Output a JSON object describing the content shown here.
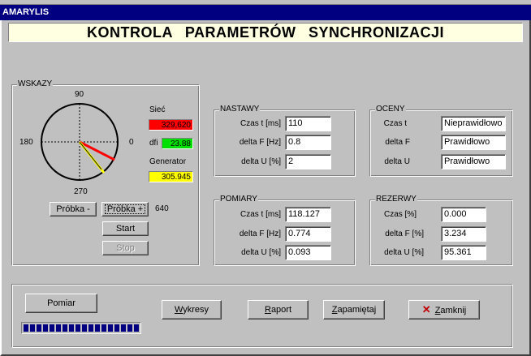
{
  "window": {
    "title": "AMARYLIS"
  },
  "banner": {
    "text": "KONTROLA   PARAMETRÓW   SYNCHRONIZACJI"
  },
  "wskazy": {
    "title": "WSKAZY",
    "dial": {
      "top": "90",
      "left": "180",
      "right": "0",
      "bottom": "270"
    },
    "siec_label": "Sieć",
    "siec_value": "329,620",
    "dfi_label": "dfi",
    "dfi_value": "23.88",
    "generator_label": "Generator",
    "generator_value": "305.945",
    "colors": {
      "siec": "#ff0000",
      "dfi": "#00e000",
      "generator": "#ffff00"
    },
    "probka_minus": "Próbka -",
    "probka_plus": "Próbka +",
    "probka_count": "640",
    "start": "Start",
    "stop": "Stop"
  },
  "nastawy": {
    "title": "NASTAWY",
    "rows": [
      {
        "label": "Czas t [ms]",
        "value": "110"
      },
      {
        "label": "delta F [Hz]",
        "value": "0.8"
      },
      {
        "label": "delta U [%]",
        "value": "2"
      }
    ]
  },
  "oceny": {
    "title": "OCENY",
    "rows": [
      {
        "label": "Czas t",
        "value": "Nieprawidłowo"
      },
      {
        "label": "delta F",
        "value": "Prawidłowo"
      },
      {
        "label": "delta U",
        "value": "Prawidłowo"
      }
    ]
  },
  "pomiary": {
    "title": "POMIARY",
    "rows": [
      {
        "label": "Czas t [ms]",
        "value": "118.127"
      },
      {
        "label": "delta F [Hz]",
        "value": "0.774"
      },
      {
        "label": "delta U [%]",
        "value": "0.093"
      }
    ]
  },
  "rezerwy": {
    "title": "REZERWY",
    "rows": [
      {
        "label": "Czas [%]",
        "value": "0.000"
      },
      {
        "label": "delta F [%]",
        "value": "3.234"
      },
      {
        "label": "delta U [%]",
        "value": "95.361"
      }
    ]
  },
  "bottom": {
    "pomiar": "Pomiar",
    "wykresy_u": "W",
    "wykresy_rest": "ykresy",
    "raport_u": "R",
    "raport_rest": "aport",
    "zapamietaj_u": "Z",
    "zapamietaj_rest": "apamiętaj",
    "zamknij_u": "Z",
    "zamknij_rest": "amknij",
    "progress": 1.0
  }
}
